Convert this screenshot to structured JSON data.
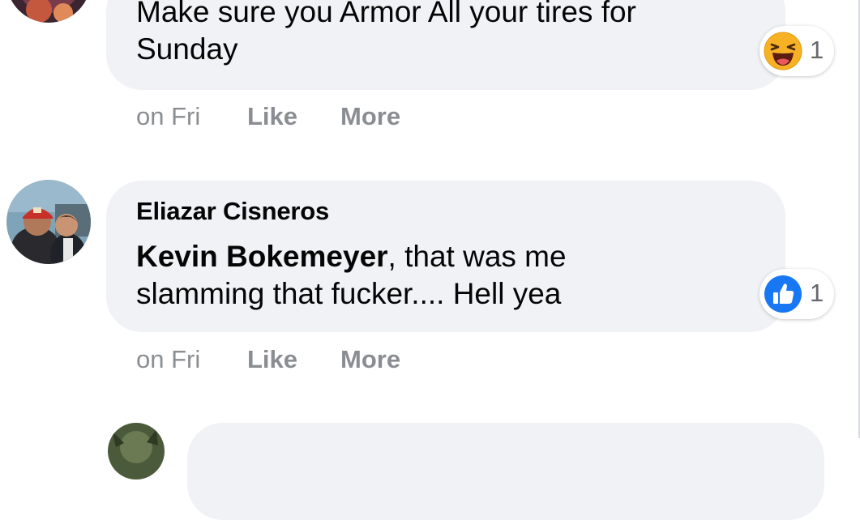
{
  "comments": [
    {
      "author": "",
      "text": "Make sure you Armor All your tires for Sunday",
      "line1": "Make sure you Armor All your tires for",
      "line2": "Sunday",
      "time": "on Fri",
      "like_label": "Like",
      "more_label": "More",
      "reaction": {
        "icon": "haha-emoji-icon",
        "count": "1",
        "color": "#f7b125"
      }
    },
    {
      "author": "Eliazar Cisneros",
      "mention": "Kevin Bokemeyer",
      "text_after_mention": ", that was me",
      "line2": "slamming that fucker.... Hell yea",
      "time": "on Fri",
      "like_label": "Like",
      "more_label": "More",
      "reaction": {
        "icon": "thumbs-up-icon",
        "count": "1",
        "color": "#1877f2"
      }
    }
  ],
  "colors": {
    "bubble": "#f0f2f5",
    "meta_text": "#8a8d91",
    "like_blue": "#1877f2",
    "haha_yellow": "#f7b125"
  }
}
